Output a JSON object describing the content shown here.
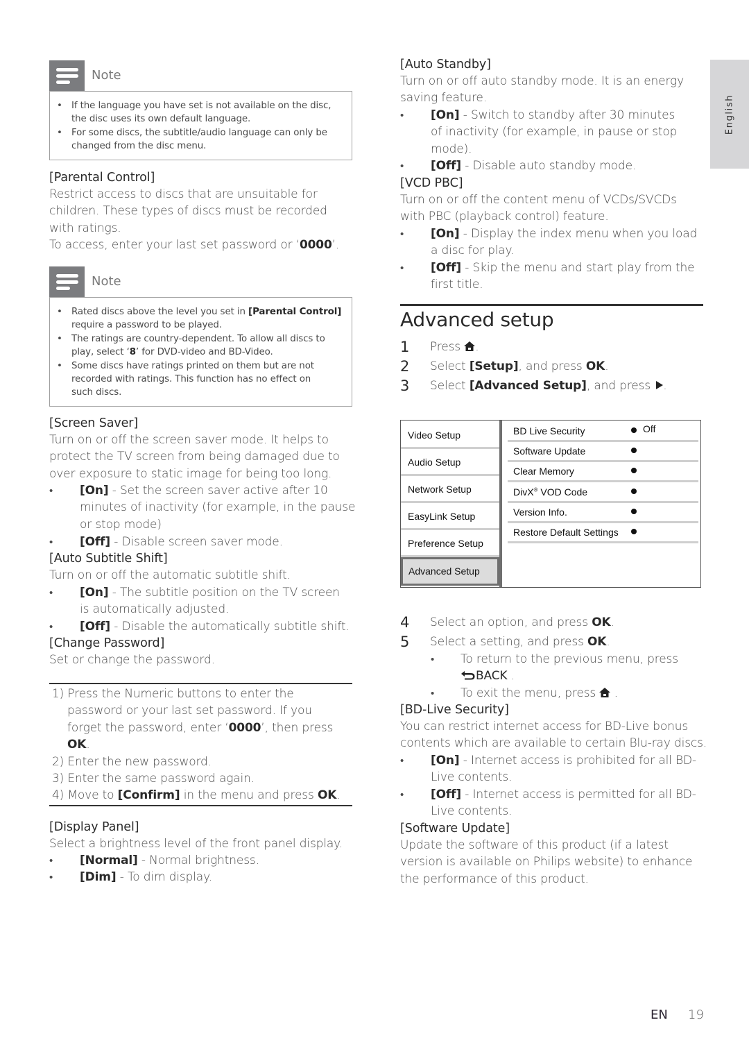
{
  "side_tab": {
    "label": "English"
  },
  "left": {
    "note1": {
      "title": "Note",
      "items": [
        [
          "If the language you have set is not available on the disc,",
          "the disc uses its own default language."
        ],
        [
          "For some discs, the subtitle/audio language can only be",
          "changed from the disc menu."
        ]
      ]
    },
    "parental": {
      "heading": "[Parental Control]",
      "lines": [
        "Restrict access to discs that are unsuitable for",
        "children. These types of discs must be recorded",
        "with ratings."
      ],
      "access_pre": "To access, enter your last set password or ‘",
      "access_code": "0000",
      "access_post": "’."
    },
    "note2": {
      "title": "Note",
      "item1_pre": "Rated discs above the level you set in ",
      "item1_bold": "[Parental Control]",
      "item1_line2": "require a password to be played.",
      "item2_line1": "The ratings are country-dependent. To allow all discs to",
      "item2_pre": "play, select ‘",
      "item2_bold": "8",
      "item2_post": "’ for DVD-video and BD-Video.",
      "item3_lines": [
        "Some discs have ratings printed on them but are not",
        "recorded with ratings. This function has no effect on",
        "such discs."
      ]
    },
    "screen_saver": {
      "heading": "[Screen Saver]",
      "lines": [
        "Turn on or off the screen saver mode. It helps to",
        "protect the TV screen from being damaged due to",
        "over exposure to static image for being too long."
      ],
      "on_label": "[On]",
      "on_lines": [
        " - Set the screen saver active after 10",
        "minutes of inactivity (for example, in the pause",
        "or stop mode)"
      ],
      "off_label": "[Off]",
      "off_text": " - Disable screen saver mode."
    },
    "auto_subtitle": {
      "heading": "[Auto Subtitle Shift]",
      "line": "Turn on or off the automatic subtitle shift.",
      "on_label": "[On]",
      "on_lines": [
        " - The subtitle position on the TV screen",
        "is automatically adjusted."
      ],
      "off_label": "[Off]",
      "off_text": " - Disable the automatically subtitle shift."
    },
    "change_password": {
      "heading": "[Change Password]",
      "line": "Set or change the password."
    },
    "password_steps": {
      "s1_line1": "1) Press the Numeric buttons to enter the",
      "s1_line2": "password or your last set password. If you",
      "s1_line3_pre": "forget the password, enter ‘",
      "s1_line3_bold": "0000",
      "s1_line3_post": "’, then press",
      "s1_line4_bold": "OK",
      "s1_line4_post": ".",
      "s2": "2) Enter the new password.",
      "s3": "3) Enter the same password again.",
      "s4_pre": "4) Move to ",
      "s4_bold": "[Confirm]",
      "s4_mid": " in the menu and press ",
      "s4_bold2": "OK",
      "s4_post": "."
    },
    "display_panel": {
      "heading": "[Display Panel]",
      "line": "Select a brightness level of the front panel display.",
      "normal_label": "[Normal]",
      "normal_text": " - Normal brightness.",
      "dim_label": "[Dim]",
      "dim_text": " - To dim display."
    }
  },
  "right": {
    "auto_standby": {
      "heading": "[Auto Standby]",
      "lines": [
        "Turn on or off auto standby mode. It is an energy",
        "saving feature."
      ],
      "on_label": "[On]",
      "on_lines": [
        " - Switch to standby after 30 minutes",
        "of inactivity (for example, in pause or stop",
        "mode)."
      ],
      "off_label": "[Off]",
      "off_text": " - Disable auto standby mode."
    },
    "vcd_pbc": {
      "heading": "[VCD PBC]",
      "lines": [
        "Turn on or off the content menu of VCDs/SVCDs",
        "with PBC (playback control) feature."
      ],
      "on_label": "[On]",
      "on_lines": [
        " - Display the index menu when you load",
        "a disc for play."
      ],
      "off_label": "[Off]",
      "off_lines": [
        " - Skip the menu and start play from the",
        "first title."
      ]
    },
    "advanced": {
      "title": "Advanced setup",
      "steps": [
        {
          "num": "1",
          "pre": "Press ",
          "post": "."
        },
        {
          "num": "2",
          "pre": "Select ",
          "bold": "[Setup]",
          "mid": ", and press ",
          "bold2": "OK",
          "post": "."
        },
        {
          "num": "3",
          "pre": "Select ",
          "bold": "[Advanced Setup]",
          "mid": ", and press ",
          "post": "."
        },
        {
          "num": "4",
          "pre": "Select an option, and press ",
          "bold": "OK",
          "post": "."
        },
        {
          "num": "5",
          "pre": "Select a setting, and press ",
          "bold": "OK",
          "post": "."
        }
      ],
      "sub1_line1": "To return to the previous menu, press",
      "sub1_back": "BACK",
      "sub1_post": " .",
      "sub2_pre": "To exit the menu, press ",
      "sub2_post": " ."
    },
    "menu": {
      "left_items": [
        "Video Setup",
        "Audio Setup",
        "Network Setup",
        "EasyLink Setup",
        "Preference Setup",
        "Advanced Setup"
      ],
      "active_index": 5,
      "right_items": [
        {
          "label": "BD Live Security",
          "value": "Off"
        },
        {
          "label": "Software Update",
          "value": ""
        },
        {
          "label": "Clear Memory",
          "value": ""
        },
        {
          "label": "DivX",
          "sup": "®",
          "label_post": " VOD Code",
          "value": ""
        },
        {
          "label": "Version Info.",
          "value": ""
        },
        {
          "label": "Restore Default Settings",
          "value": ""
        }
      ]
    },
    "bd_live": {
      "heading": "[BD-Live Security]",
      "lines": [
        "You can restrict internet access for BD-Live bonus",
        "contents which are available to certain Blu-ray discs."
      ],
      "on_label": "[On]",
      "on_lines": [
        " - Internet access is prohibited for all BD-",
        "Live contents."
      ],
      "off_label": "[Off]",
      "off_lines": [
        " - Internet access is permitted for all BD-",
        "Live contents."
      ]
    },
    "software_update": {
      "heading": "[Software Update]",
      "lines": [
        "Update the software of this product (if a latest",
        "version is available on Philips website) to enhance",
        "the performance of this product."
      ]
    }
  },
  "footer": {
    "lang": "EN",
    "page": "19"
  }
}
